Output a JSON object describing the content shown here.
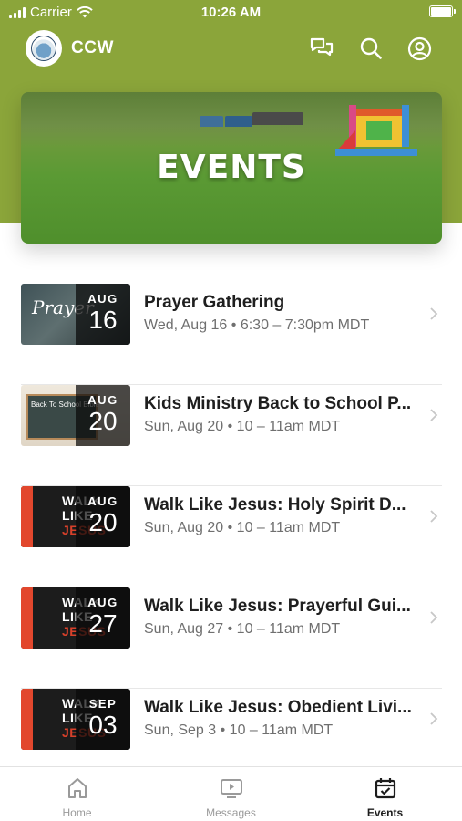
{
  "status_bar": {
    "carrier": "Carrier",
    "time": "10:26 AM"
  },
  "header": {
    "title": "CCW"
  },
  "hero": {
    "title": "EVENTS"
  },
  "events": [
    {
      "title": "Prayer Gathering",
      "meta": "Wed, Aug 16 • 6:30 – 7:30pm MDT",
      "month": "AUG",
      "day": "16",
      "thumb_text": "Prayer"
    },
    {
      "title": "Kids Ministry Back to School P...",
      "meta": "Sun, Aug 20 • 10 – 11am MDT",
      "month": "AUG",
      "day": "20",
      "thumb_text": "Back To School Bible"
    },
    {
      "title": "Walk Like Jesus: Holy Spirit D...",
      "meta": "Sun, Aug 20 • 10 – 11am MDT",
      "month": "AUG",
      "day": "20",
      "thumb_text": [
        "WALK",
        "LIKE",
        "JESUS"
      ]
    },
    {
      "title": "Walk Like Jesus: Prayerful Gui...",
      "meta": "Sun, Aug 27 • 10 – 11am MDT",
      "month": "AUG",
      "day": "27",
      "thumb_text": [
        "WALK",
        "LIKE",
        "JESUS"
      ]
    },
    {
      "title": "Walk Like Jesus: Obedient Livi...",
      "meta": "Sun, Sep 3 • 10 – 11am MDT",
      "month": "SEP",
      "day": "03",
      "thumb_text": [
        "WALK",
        "LIKE",
        "JESUS"
      ]
    }
  ],
  "tab_bar": {
    "tabs": [
      {
        "label": "Home",
        "icon": "home-icon",
        "active": false
      },
      {
        "label": "Messages",
        "icon": "tv-play-icon",
        "active": false
      },
      {
        "label": "Events",
        "icon": "calendar-check-icon",
        "active": true
      }
    ]
  },
  "colors": {
    "brand_green": "#8ba53a",
    "accent_red": "#e2472d",
    "text_dark": "#1f1f1f",
    "text_muted": "#6f6f6f"
  }
}
